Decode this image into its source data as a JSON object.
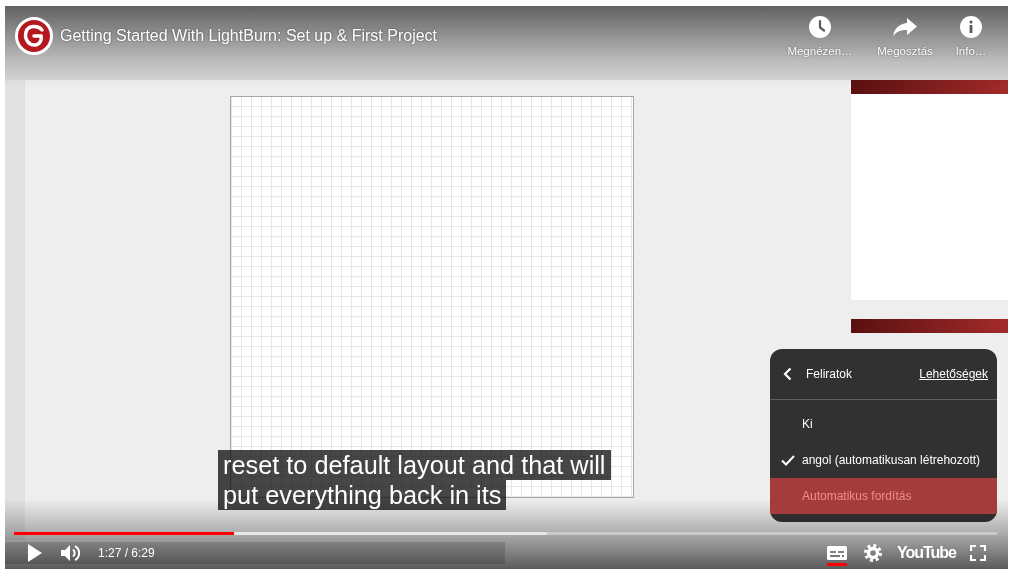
{
  "video": {
    "title": "Getting Started With LightBurn: Set up & First Project"
  },
  "top_actions": [
    {
      "kind": "watch_later",
      "label": "Megnézen…"
    },
    {
      "kind": "share",
      "label": "Megosztás"
    },
    {
      "kind": "info",
      "label": "Info…"
    }
  ],
  "captions": [
    "reset to default layout and that will",
    "put everything back in its"
  ],
  "subtitles_menu": {
    "title": "Feliratok",
    "options_link": "Lehetőségek",
    "items": [
      {
        "label": "Ki",
        "selected": false,
        "highlighted": false
      },
      {
        "label": "angol (automatikusan létrehozott)",
        "selected": true,
        "highlighted": false
      },
      {
        "label": "Automatikus fordítás",
        "selected": false,
        "highlighted": true
      }
    ]
  },
  "progress": {
    "level": 0.224,
    "buffer": {
      "level": 0.542
    }
  },
  "controls": {
    "time": "1:27 / 6:29",
    "captions_on": true,
    "logo": "YouTube"
  }
}
